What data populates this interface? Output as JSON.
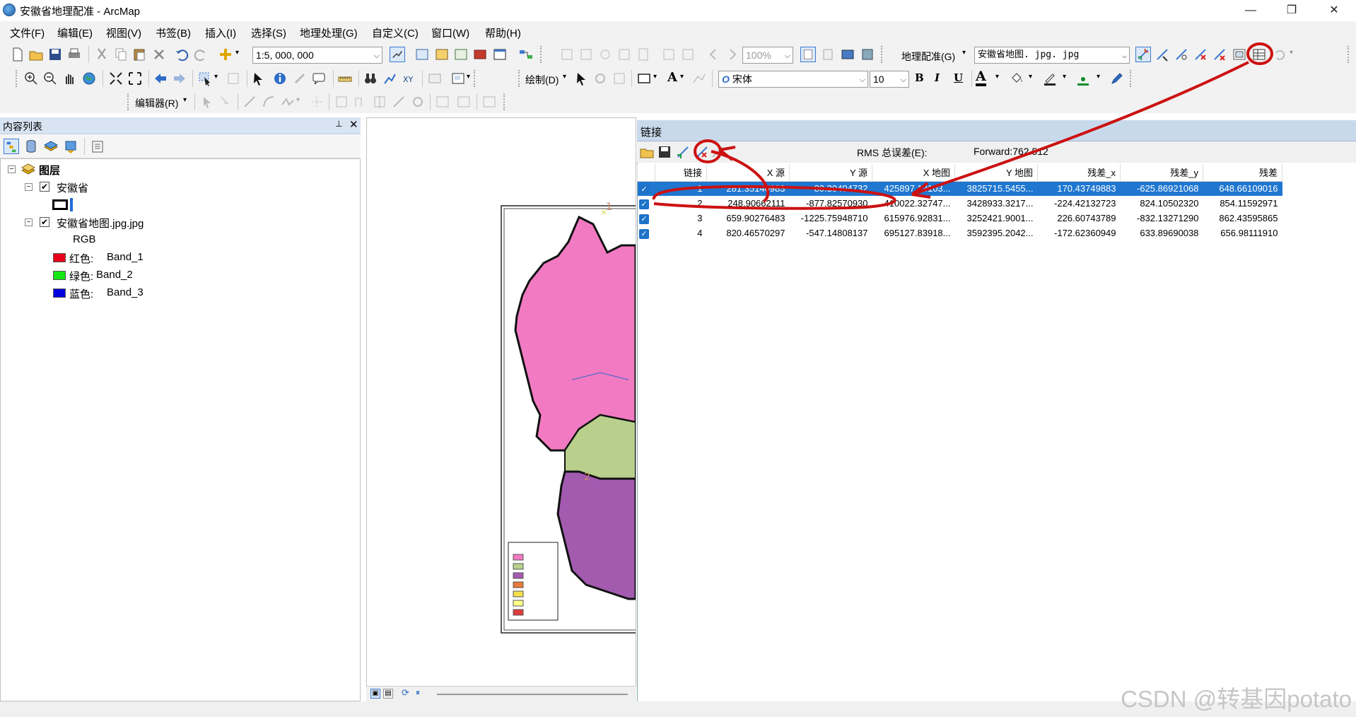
{
  "window": {
    "title": "安徽省地理配准 - ArcMap",
    "minimize": "—",
    "restore": "❐",
    "close": "✕"
  },
  "menu": [
    "文件(F)",
    "编辑(E)",
    "视图(V)",
    "书签(B)",
    "插入(I)",
    "选择(S)",
    "地理处理(G)",
    "自定义(C)",
    "窗口(W)",
    "帮助(H)"
  ],
  "toolbar": {
    "scale": "1:5, 000, 000",
    "zoom": "100%",
    "georef_label": "地理配准(G)",
    "georef_layer": "安徽省地图. jpg. jpg",
    "draw_label": "绘制(D)",
    "font_name": "宋体",
    "font_size": "10",
    "bold": "B",
    "italic": "I",
    "underline": "U",
    "font_color": "A",
    "editor_label": "编辑器(R)"
  },
  "toc": {
    "title": "内容列表",
    "pin": "📌",
    "close": "✕",
    "layers_label": "图层",
    "layer1": "安徽省",
    "layer2": "安徽省地图.jpg.jpg",
    "rgb": "RGB",
    "bands": [
      {
        "label": "红色:",
        "band": "Band_1",
        "color": "#e8001b"
      },
      {
        "label": "绿色:",
        "band": "Band_2",
        "color": "#14e614"
      },
      {
        "label": "蓝色:",
        "band": "Band_3",
        "color": "#0000e0"
      }
    ]
  },
  "map_legend_rows": 7,
  "link_window": {
    "title": "链接",
    "rms_label": "RMS 总误差(E):",
    "rms_value": "Forward:762.512",
    "columns": [
      "链接",
      "X 源",
      "Y 源",
      "X 地图",
      "Y 地图",
      "残差_x",
      "残差_y",
      "残差"
    ],
    "rows": [
      {
        "id": "1",
        "xs": "281.35140983",
        "ys": "-80.30404732",
        "xm": "425897.13103...",
        "ym": "3825715.5455...",
        "rx": "170.43749883",
        "ry": "-625.86921068",
        "r": "648.66109016",
        "selected": true
      },
      {
        "id": "2",
        "xs": "248.90662111",
        "ys": "-877.82570930",
        "xm": "410022.32747...",
        "ym": "3428933.3217...",
        "rx": "-224.42132723",
        "ry": "824.10502320",
        "r": "854.11592971",
        "selected": false
      },
      {
        "id": "3",
        "xs": "659.90276483",
        "ys": "-1225.75948710",
        "xm": "615976.92831...",
        "ym": "3252421.9001...",
        "rx": "226.60743789",
        "ry": "-832.13271290",
        "r": "862.43595865",
        "selected": false
      },
      {
        "id": "4",
        "xs": "820.46570297",
        "ys": "-547.14808137",
        "xm": "695127.83918...",
        "ym": "3592395.2042...",
        "rx": "-172.62360949",
        "ry": "633.89690038",
        "r": "656.98111910",
        "selected": false
      }
    ]
  },
  "map_points": [
    "1",
    "2"
  ],
  "watermark": "CSDN @转基因potato",
  "annotation_color": "#cc1111"
}
